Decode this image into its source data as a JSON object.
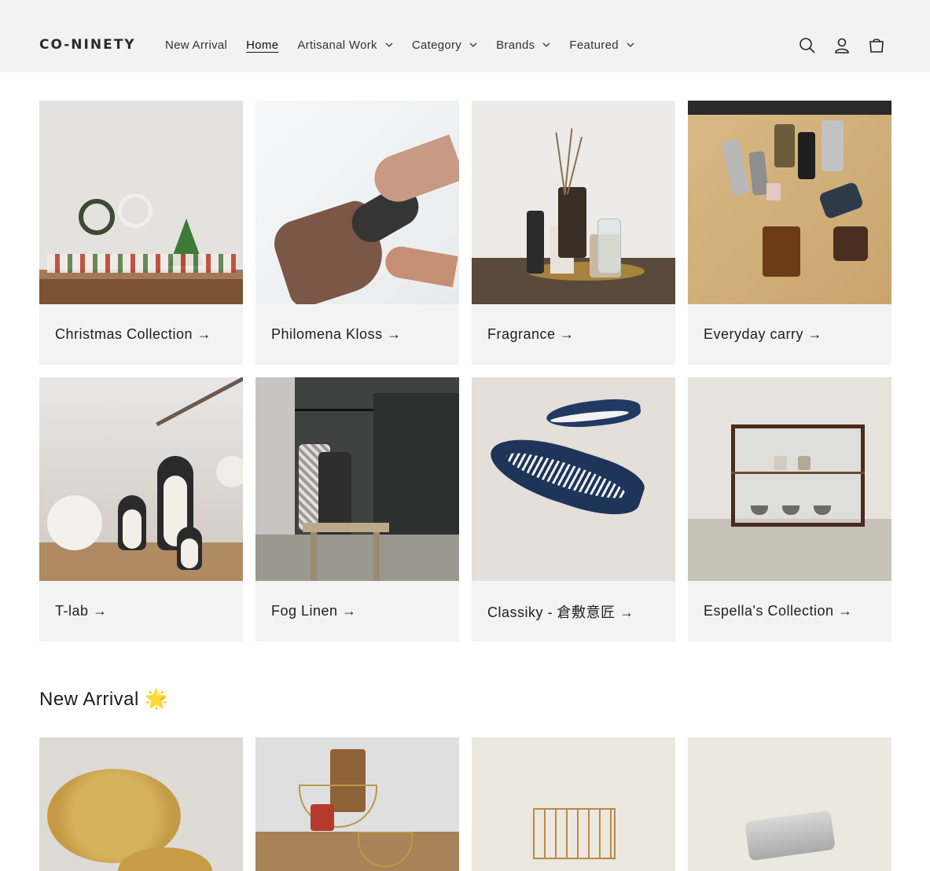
{
  "header": {
    "logo": "CO-NINETY",
    "nav": [
      {
        "label": "New Arrival",
        "dropdown": false,
        "active": false
      },
      {
        "label": "Home",
        "dropdown": false,
        "active": true
      },
      {
        "label": "Artisanal Work",
        "dropdown": true,
        "active": false
      },
      {
        "label": "Category",
        "dropdown": true,
        "active": false
      },
      {
        "label": "Brands",
        "dropdown": true,
        "active": false
      },
      {
        "label": "Featured",
        "dropdown": true,
        "active": false
      }
    ],
    "icons": [
      "search-icon",
      "account-icon",
      "cart-icon"
    ]
  },
  "collections": [
    {
      "title": "Christmas Collection →"
    },
    {
      "title": "Philomena Kloss →"
    },
    {
      "title": "Fragrance →"
    },
    {
      "title": "Everyday carry →"
    },
    {
      "title": "T-lab →"
    },
    {
      "title": "Fog Linen →"
    },
    {
      "title": "Classiky - 倉敷意匠 →"
    },
    {
      "title": "Espella's Collection →"
    }
  ],
  "new_arrival": {
    "title": "New Arrival 🌟"
  },
  "colors": {
    "header_bg": "#f2f2f2",
    "card_bg": "#f3f3f3",
    "text": "#1e1e1e"
  }
}
